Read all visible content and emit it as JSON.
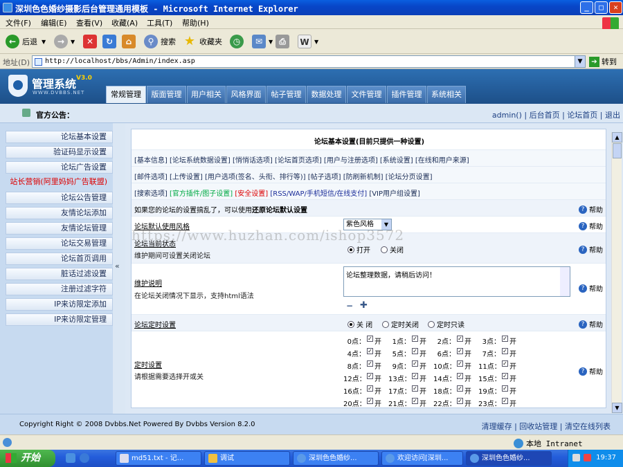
{
  "window": {
    "title": "深圳色色婚纱摄影后台管理通用模板 - Microsoft Internet Explorer",
    "min": "_",
    "max": "□",
    "close": "✕"
  },
  "menu": [
    "文件(F)",
    "编辑(E)",
    "查看(V)",
    "收藏(A)",
    "工具(T)",
    "帮助(H)"
  ],
  "toolbar": {
    "back": "后退",
    "search": "搜索",
    "favorites": "收藏夹"
  },
  "address": {
    "label": "地址(D)",
    "url": "http://localhost/bbs/Admin/index.asp",
    "go": "转到"
  },
  "app": {
    "logo_text": "管理系统",
    "logo_version": "V3.0",
    "logo_sub": "WWW.DVBBS.NET",
    "tabs": [
      "常规管理",
      "版面管理",
      "用户相关",
      "风格界面",
      "帖子管理",
      "数据处理",
      "文件管理",
      "插件管理",
      "系统相关"
    ]
  },
  "notice": {
    "label": "官方公告：",
    "user_links": "admin() | 后台首页 | 论坛首页 | 退出"
  },
  "sidebar": [
    "论坛基本设置",
    "验证码显示设置",
    "论坛广告设置",
    "站长营销(阿里妈妈广告联盟)",
    "论坛公告管理",
    "友情论坛添加",
    "友情论坛管理",
    "论坛交易管理",
    "论坛首页调用",
    "脏话过滤设置",
    "注册过滤字符",
    "IP来访限定添加",
    "IP来访限定管理"
  ],
  "collapse": "«",
  "panel": {
    "title": "论坛基本设置(目前只提供一种设置)",
    "links1": "[基本信息] [论坛系统数据设置] [悄悄话选项] [论坛首页选项] [用户与注册选项] [系统设置] [在线和用户来源]",
    "links2": "[邮件选项] [上传设置] [用户选项(签名、头衔、排行等)] [帖子选项] [防刷新机制] [论坛分页设置]",
    "links3a": "[搜索选项]",
    "links3b": "[官方插件/图子设置]",
    "links3c": "[安全设置]",
    "links3d": "[RSS/WAP/手机短信/在线支付]",
    "links3e": "[VIP用户组设置]",
    "restore_prefix": "如果您的论坛的设置搞乱了，可以使用",
    "restore_link": "还原论坛默认设置",
    "help": "帮助",
    "style_label": "论坛默认使用风格",
    "style_value": "紫色风格",
    "state_label": "论坛当前状态",
    "state_sub": "维护期间可设置关闭论坛",
    "state_open": "打开",
    "state_close": "关闭",
    "maint_label": "维护说明",
    "maint_sub": "在论坛关闭情况下显示，支持html语法",
    "maint_text": "论坛整理数据，请稍后访问！",
    "timer_label": "论坛定时设置",
    "timer_opts": [
      "关 闭",
      "定时关闭",
      "定时只读"
    ],
    "sched_label": "定时设置",
    "sched_sub": "请根据需要选择开或关",
    "hours": [
      "0点：",
      "1点：",
      "2点：",
      "3点：",
      "4点：",
      "5点：",
      "6点：",
      "7点：",
      "8点：",
      "9点：",
      "10点：",
      "11点：",
      "12点：",
      "13点：",
      "14点：",
      "15点：",
      "16点：",
      "17点：",
      "18点：",
      "19点：",
      "20点：",
      "21点：",
      "22点：",
      "23点："
    ],
    "on": "开"
  },
  "footer": {
    "copyright": "Copyright Right © 2008 Dvbbs.Net Powered By Dvbbs Version 8.2.0",
    "links": "清理缓存 | 回收站管理 | 清空在线列表"
  },
  "status": {
    "zone": "本地 Intranet"
  },
  "taskbar": {
    "start": "开始",
    "tasks": [
      "md51.txt - 记...",
      "调试",
      "深圳色色婚纱...",
      "欢迎访问[深圳...",
      "深圳色色婚纱..."
    ],
    "clock": "19:37"
  },
  "watermark": "https://www.huzhan.com/ishop3572",
  "colors": {
    "accent": "#1d4f88",
    "hot": "#dd0000",
    "link": "#1c3f82"
  }
}
